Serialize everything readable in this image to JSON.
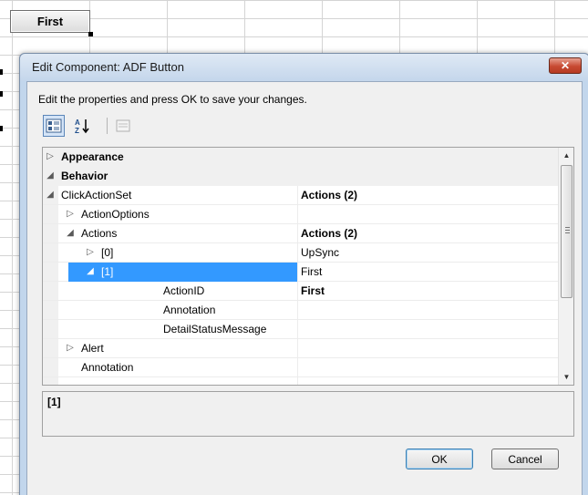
{
  "sheet": {
    "cell_button_label": "First"
  },
  "dialog": {
    "title": "Edit Component: ADF Button",
    "close_glyph": "✕",
    "instruction": "Edit the properties and press OK to save your changes.",
    "toolbar": {
      "categorized_icon": "categorized-view-icon",
      "alphabetical_icon": "alphabetical-sort-icon",
      "property_pages_icon": "property-pages-icon"
    },
    "grid_rows": [
      {
        "name": "Appearance",
        "value": "",
        "expander": "▷",
        "bold_name": true
      },
      {
        "name": "Behavior",
        "value": "",
        "expander": "◢",
        "bold_name": true
      },
      {
        "name": "ClickActionSet",
        "value": "Actions (2)",
        "expander": "◢",
        "bold_value": true
      },
      {
        "name": "ActionOptions",
        "value": "",
        "expander": "▷"
      },
      {
        "name": "Actions",
        "value": "Actions (2)",
        "expander": "◢",
        "bold_value": true
      },
      {
        "name": "[0]",
        "value": "UpSync",
        "expander": "▷"
      },
      {
        "name": "[1]",
        "value": "First",
        "expander": "◢",
        "selected": true
      },
      {
        "name": "ActionID",
        "value": "First",
        "bold_value": true
      },
      {
        "name": "Annotation",
        "value": ""
      },
      {
        "name": "DetailStatusMessage",
        "value": ""
      },
      {
        "name": "Alert",
        "value": "",
        "expander": "▷"
      },
      {
        "name": "Annotation",
        "value": ""
      }
    ],
    "description_title": "[1]",
    "ok_label": "OK",
    "cancel_label": "Cancel"
  },
  "colors": {
    "selection": "#3399ff",
    "dialog_frame": "#c2d6ec",
    "close_button": "#c74a32"
  }
}
